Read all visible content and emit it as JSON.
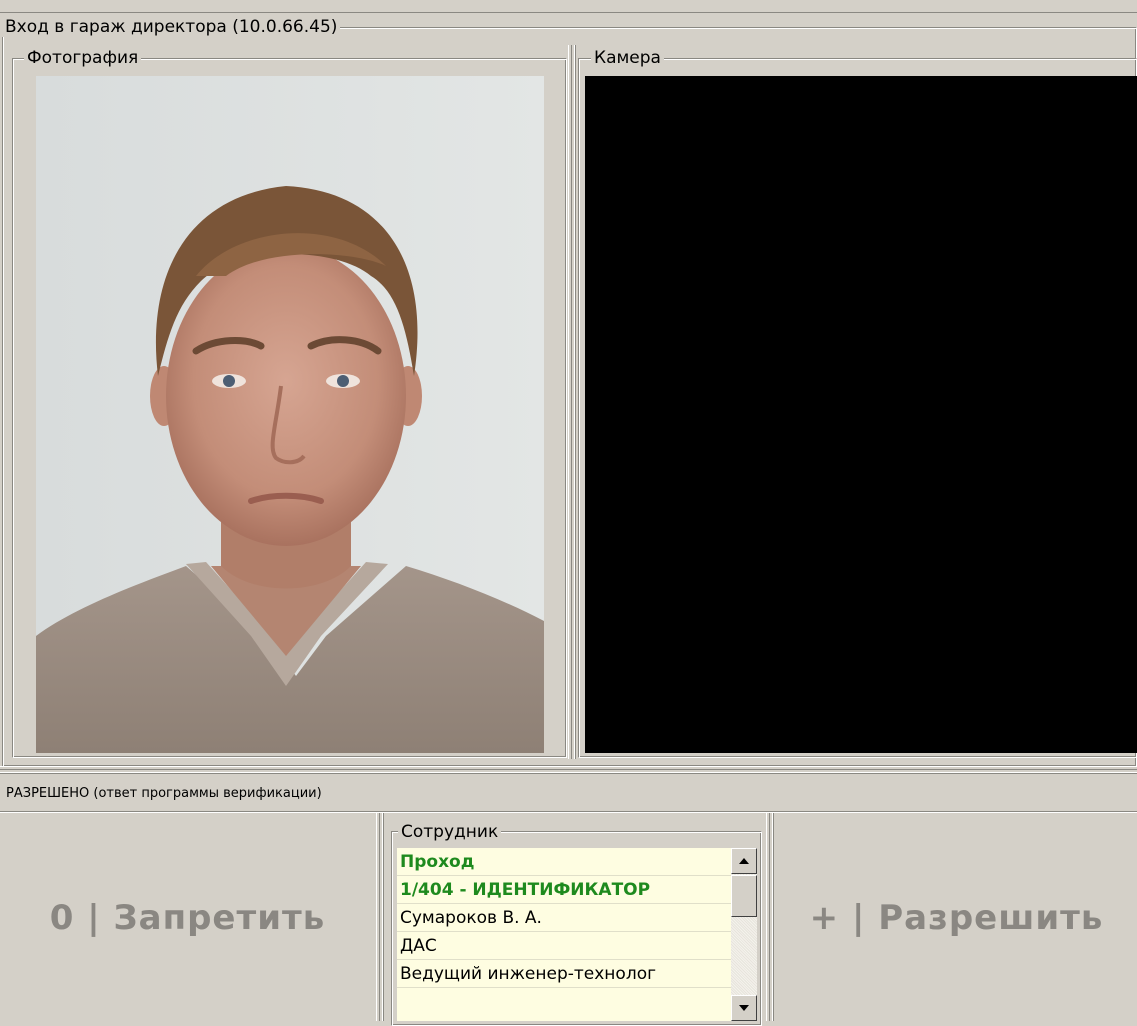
{
  "window": {
    "title": "Вход в гараж директора (10.0.66.45)"
  },
  "photo_panel": {
    "label": "Фотография"
  },
  "camera_panel": {
    "label": "Камера"
  },
  "status": {
    "text": "РАЗРЕШЕНО (ответ программы верификации)"
  },
  "buttons": {
    "deny_label": "0 | Запретить",
    "allow_label": "+ | Разрешить"
  },
  "employee": {
    "label": "Сотрудник",
    "rows": [
      "Проход",
      "1/404 - ИДЕНТИФИКАТОР",
      "Сумароков В. А.",
      "ДАС",
      "Ведущий инженер-технолог"
    ]
  },
  "colors": {
    "window_bg": "#d4d0c8",
    "list_bg": "#fefde1",
    "highlight_text": "#1e8a1e",
    "button_text": "#8a8782",
    "camera_bg": "#000000"
  },
  "icons": [
    "scroll-up-arrow-icon",
    "scroll-down-arrow-icon"
  ]
}
